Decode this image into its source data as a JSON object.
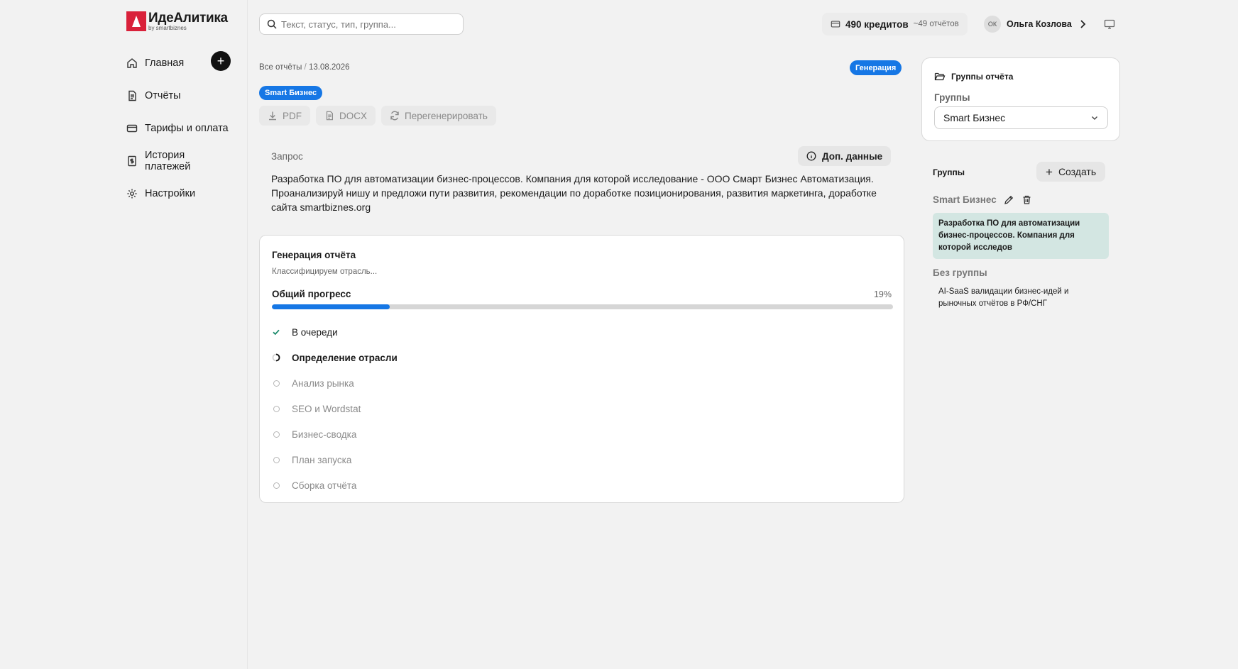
{
  "logo": {
    "name": "ИдеАлитика",
    "sub": "by smartbiznes"
  },
  "nav": [
    {
      "label": "Главная",
      "icon": "home-icon"
    },
    {
      "label": "Отчёты",
      "icon": "document-icon"
    },
    {
      "label": "Тарифы и оплата",
      "icon": "credit-card-icon"
    },
    {
      "label": "История платежей",
      "icon": "receipt-dollar-icon"
    },
    {
      "label": "Настройки",
      "icon": "gear-icon"
    }
  ],
  "search": {
    "placeholder": "Текст, статус, тип, группа..."
  },
  "credits": {
    "main": "490 кредитов",
    "sub": "~49 отчётов"
  },
  "user": {
    "initials": "ОК",
    "name": "Ольга Козлова"
  },
  "breadcrumb": {
    "root": "Все отчёты",
    "sep": "/",
    "date": "13.08.2026"
  },
  "status": "Генерация",
  "group_tag": "Smart Бизнес",
  "actions": {
    "pdf": "PDF",
    "docx": "DOCX",
    "regenerate": "Перегенерировать"
  },
  "query": {
    "label": "Запрос",
    "extra_label": "Доп. данные",
    "text": "Разработка ПО для автоматизации бизнес-процессов. Компания для которой исследование - ООО Смарт Бизнес Автоматизация. Проанализируй нишу и предложи пути развития, рекомендации по доработке позиционирования, развития маркетинга, доработке сайта smartbiznes.org"
  },
  "generation": {
    "title": "Генерация отчёта",
    "subtitle": "Классифицируем отрасль...",
    "progress_label": "Общий прогресс",
    "progress_value": 19,
    "progress_text": "19%",
    "steps": [
      {
        "label": "В очереди",
        "state": "done"
      },
      {
        "label": "Определение отрасли",
        "state": "active"
      },
      {
        "label": "Анализ рынка",
        "state": "pending"
      },
      {
        "label": "SEO и Wordstat",
        "state": "pending"
      },
      {
        "label": "Бизнес-сводка",
        "state": "pending"
      },
      {
        "label": "План запуска",
        "state": "pending"
      },
      {
        "label": "Сборка отчёта",
        "state": "pending"
      }
    ]
  },
  "report_groups": {
    "title": "Группы отчёта",
    "label": "Группы",
    "selected": "Smart Бизнес"
  },
  "groups": {
    "title": "Группы",
    "create_label": "Создать",
    "group_name": "Smart Бизнес",
    "group_report": "Разработка ПО для автоматизации бизнес-процессов. Компания для которой исследов",
    "nogroup_label": "Без группы",
    "nogroup_report": "AI-SaaS валидации бизнес-идей и рыночных отчётов в РФ/СНГ"
  },
  "colors": {
    "accent": "#1677e5",
    "brand": "#d9213a",
    "selected_bg": "#d3e6e2",
    "done": "#1b8a6b"
  }
}
